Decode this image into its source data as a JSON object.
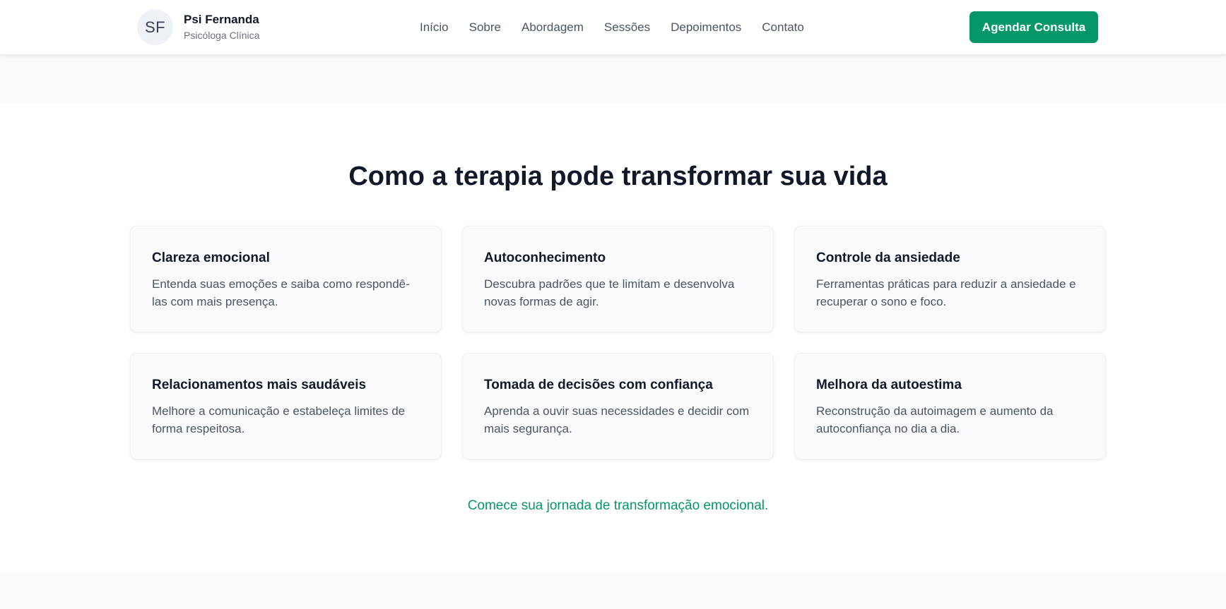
{
  "header": {
    "avatar_initials": "SF",
    "brand_name": "Psi Fernanda",
    "brand_role": "Psicóloga Clínica",
    "nav": [
      "Início",
      "Sobre",
      "Abordagem",
      "Sessões",
      "Depoimentos",
      "Contato"
    ],
    "cta_label": "Agendar Consulta"
  },
  "section": {
    "title": "Como a terapia pode transformar sua vida",
    "cards": [
      {
        "title": "Clareza emocional",
        "text": "Entenda suas emoções e saiba como respondê-las com mais presença."
      },
      {
        "title": "Autoconhecimento",
        "text": "Descubra padrões que te limitam e desenvolva novas formas de agir."
      },
      {
        "title": "Controle da ansiedade",
        "text": "Ferramentas práticas para reduzir a ansiedade e recuperar o sono e foco."
      },
      {
        "title": "Relacionamentos mais saudáveis",
        "text": "Melhore a comunicação e estabeleça limites de forma respeitosa."
      },
      {
        "title": "Tomada de decisões com confiança",
        "text": "Aprenda a ouvir suas necessidades e decidir com mais segurança."
      },
      {
        "title": "Melhora da autoestima",
        "text": "Reconstrução da autoimagem e aumento da autoconfiança no dia a dia."
      }
    ],
    "tagline": "Comece sua jornada de transformação emocional."
  },
  "colors": {
    "accent": "#059669",
    "heading": "#111827",
    "body_text": "#4b5563",
    "card_bg": "#f9fafb"
  }
}
